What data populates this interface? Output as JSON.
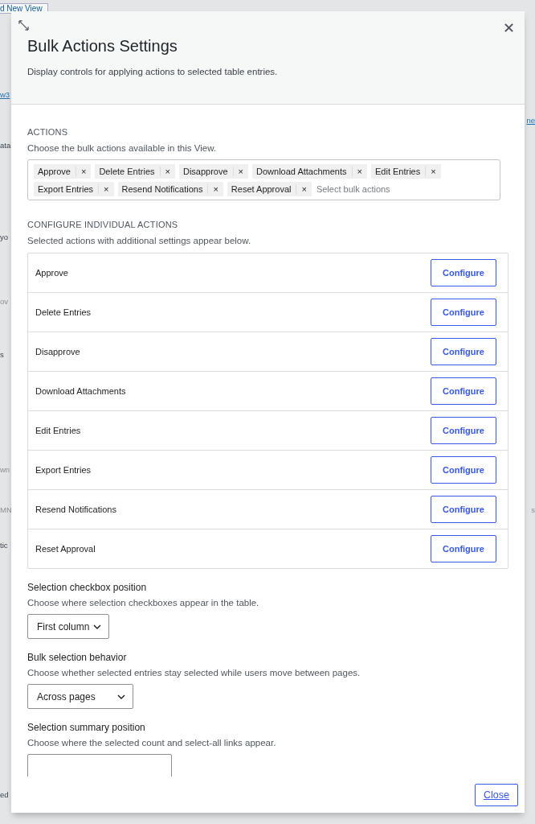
{
  "background": {
    "top_link": "d New View",
    "left_fragments": [
      {
        "kind": "link",
        "text": "w3"
      },
      {
        "kind": "text",
        "text": "ata"
      },
      {
        "kind": "text",
        "text": "yo"
      },
      {
        "kind": "muted",
        "text": "ov"
      },
      {
        "kind": "text",
        "text": "s"
      },
      {
        "kind": "muted",
        "text": "wn"
      },
      {
        "kind": "muted",
        "text": "MN"
      },
      {
        "kind": "text",
        "text": "tic"
      },
      {
        "kind": "text",
        "text": "ed"
      }
    ],
    "right_fragments": [
      {
        "kind": "link",
        "text": "ne"
      },
      {
        "kind": "muted",
        "text": "s"
      }
    ]
  },
  "modal": {
    "title": "Bulk Actions Settings",
    "description": "Display controls for applying actions to selected table entries.",
    "actions": {
      "heading": "ACTIONS",
      "help": "Choose the bulk actions available in this View.",
      "tags": [
        {
          "label": "Approve",
          "remove": "×"
        },
        {
          "label": "Delete Entries",
          "remove": "×"
        },
        {
          "label": "Disapprove",
          "remove": "×"
        },
        {
          "label": "Download Attachments",
          "remove": "×"
        },
        {
          "label": "Edit Entries",
          "remove": "×"
        },
        {
          "label": "Export Entries",
          "remove": "×"
        },
        {
          "label": "Resend Notifications",
          "remove": "×"
        },
        {
          "label": "Reset Approval",
          "remove": "×"
        }
      ],
      "placeholder": "Select bulk actions"
    },
    "configure": {
      "heading": "CONFIGURE INDIVIDUAL ACTIONS",
      "help": "Selected actions with additional settings appear below.",
      "rows": [
        {
          "name": "Approve",
          "button": "Configure"
        },
        {
          "name": "Delete Entries",
          "button": "Configure"
        },
        {
          "name": "Disapprove",
          "button": "Configure"
        },
        {
          "name": "Download Attachments",
          "button": "Configure"
        },
        {
          "name": "Edit Entries",
          "button": "Configure"
        },
        {
          "name": "Export Entries",
          "button": "Configure"
        },
        {
          "name": "Resend Notifications",
          "button": "Configure"
        },
        {
          "name": "Reset Approval",
          "button": "Configure"
        }
      ]
    },
    "settings": [
      {
        "label": "Selection checkbox position",
        "help": "Choose where selection checkboxes appear in the table.",
        "value": "First column"
      },
      {
        "label": "Bulk selection behavior",
        "help": "Choose whether selected entries stay selected while users move between pages.",
        "value": "Across pages"
      },
      {
        "label": "Selection summary position",
        "help": "Choose where the selected count and select-all links appear."
      }
    ],
    "close_button": "Close"
  }
}
